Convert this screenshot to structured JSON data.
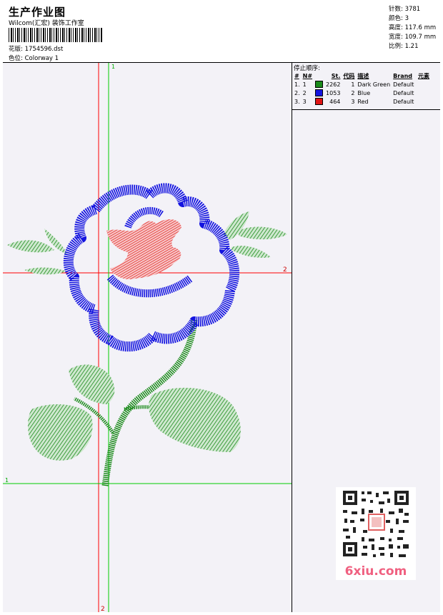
{
  "header": {
    "title": "生产作业图",
    "company": "Wilcom(汇宏) 装饰工作室",
    "design_label": "花版:",
    "design_value": "1754596.dst",
    "colorway_label": "色位:",
    "colorway_value": "Colorway 1"
  },
  "stats": {
    "stitches": "针数: 3781",
    "colors": "颜色: 3",
    "height": "高度: 117.6 mm",
    "width": "宽度: 109.7 mm",
    "ratio": "比例: 1.21"
  },
  "guides": {
    "top_mark": "1",
    "right_mark": "2",
    "left_mark": "1",
    "bottom_mark": "2"
  },
  "stop_sequence": {
    "title": "停止顺序:",
    "columns": [
      "#",
      "N#",
      "St.",
      "代码",
      "描述",
      "Brand",
      "元素"
    ],
    "rows": [
      {
        "n": "1.",
        "needle": "1",
        "color": "#1a8a1a",
        "stitches": "2262",
        "code": "1",
        "desc": "Dark Green",
        "brand": "Default"
      },
      {
        "n": "2.",
        "needle": "2",
        "color": "#1414e0",
        "stitches": "1053",
        "code": "2",
        "desc": "Blue",
        "brand": "Default"
      },
      {
        "n": "3.",
        "needle": "3",
        "color": "#e01414",
        "stitches": "464",
        "code": "3",
        "desc": "Red",
        "brand": "Default"
      }
    ]
  },
  "watermark": {
    "site": "6xiu.com"
  },
  "colors": {
    "green": "#1a8a1a",
    "blue": "#1414e0",
    "red": "#e01414",
    "guide_red": "#ff0000",
    "guide_green": "#00cc00"
  }
}
